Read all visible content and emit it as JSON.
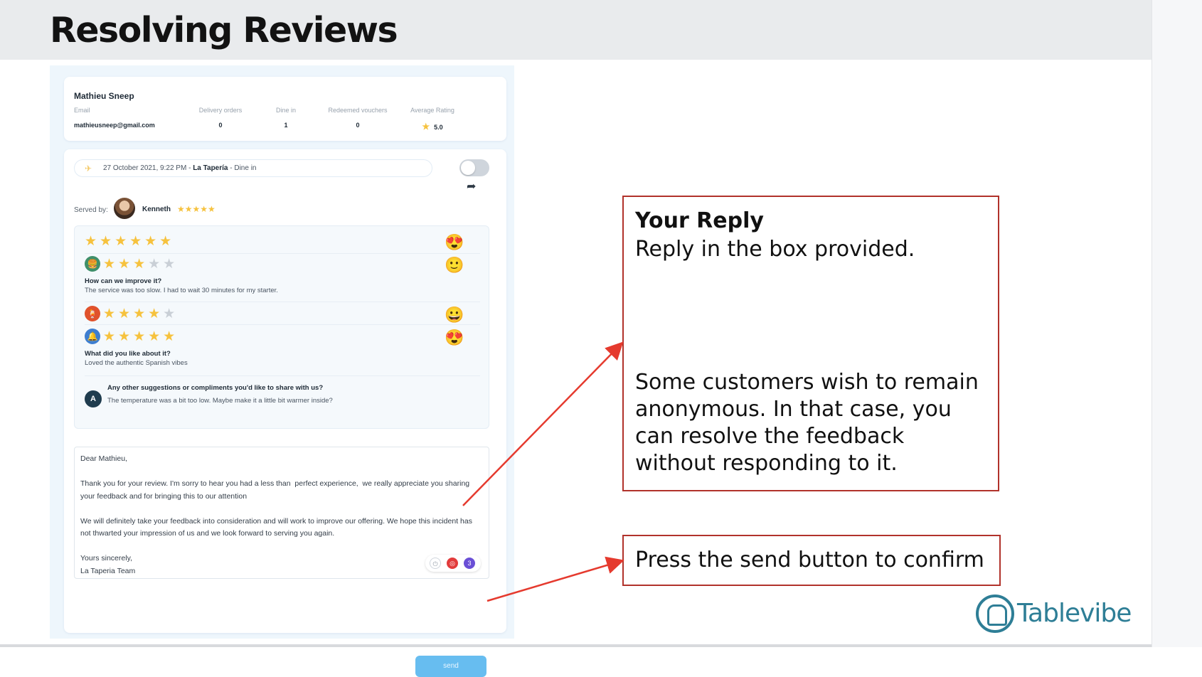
{
  "slide": {
    "title": "Resolving Reviews",
    "brand": "Tablevibe",
    "colors": {
      "callout_border": "#b1322b",
      "arrow": "#e53a2e",
      "send_button": "#67bdf0",
      "brand": "#2e7e96",
      "star": "#f6c23e"
    }
  },
  "profile": {
    "name": "Mathieu Sneep",
    "email_label": "Email",
    "email": "mathieusneep@gmail.com",
    "delivery_label": "Delivery orders",
    "delivery_value": "0",
    "dinein_label": "Dine in",
    "dinein_value": "1",
    "vouchers_label": "Redeemed vouchers",
    "vouchers_value": "0",
    "avg_label": "Average Rating",
    "avg_value": "5.0"
  },
  "review": {
    "date": "27 October 2021, 9:22 PM - ",
    "venue": "La Tapería",
    "type": " - Dine in",
    "served_label": "Served by:",
    "waiter": "Kenneth",
    "waiter_stars": "★★★★★",
    "q1": "How can we improve it?",
    "a1": "The service was too slow. I had to wait 30 minutes for my starter.",
    "q2": "What did you like about it?",
    "a2": "Loved the authentic Spanish vibes",
    "anon_initial": "A",
    "q3": "Any other suggestions or compliments you'd like to share with us?",
    "a3": "The temperature was a bit too low. Maybe make it a little bit warmer inside?",
    "ratings": [
      {
        "icon": "star-icon",
        "filled": 6,
        "total": 6,
        "emoji": "😍"
      },
      {
        "icon": "food-icon",
        "filled": 3,
        "total": 5,
        "emoji": "🙂"
      },
      {
        "icon": "drink-icon",
        "filled": 4,
        "total": 5,
        "emoji": "😀"
      },
      {
        "icon": "ambience-icon",
        "filled": 5,
        "total": 5,
        "emoji": "😍"
      }
    ]
  },
  "reply": {
    "text": "Dear Mathieu,\n\nThank you for your review. I'm sorry to hear you had a less than  perfect experience,  we really appreciate you sharing your feedback and for bringing this to our attention\n\nWe will definitely take your feedback into consideration and will work to improve our offering. We hope this incident has not thwarted your impression of us and we look forward to serving you again.\n\nYours sincerely,\nLa Taperia Team",
    "send_label": "send",
    "badge_count": "3"
  },
  "callouts": {
    "reply_title": "Your Reply",
    "reply_sub": "Reply in the box provided.",
    "reply_body": "Some customers wish to remain anonymous. In that case, you can resolve the feedback without responding to it.",
    "send_text": "Press the send button to confirm"
  }
}
